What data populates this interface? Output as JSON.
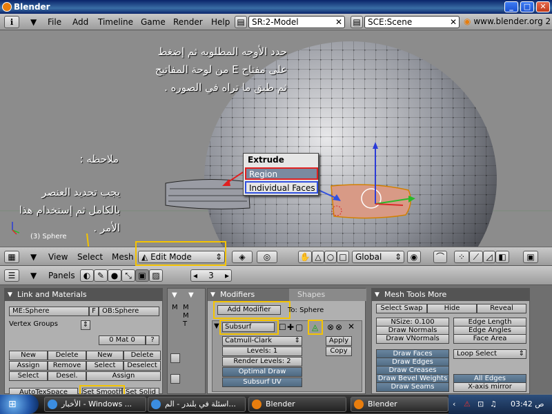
{
  "window": {
    "title": "Blender",
    "min": "_",
    "max": "□",
    "close": "✕"
  },
  "menubar": {
    "items": [
      "File",
      "Add",
      "Timeline",
      "Game",
      "Render",
      "Help"
    ],
    "screen": "SR:2-Model",
    "scene": "SCE:Scene",
    "url": "www.blender.org 2"
  },
  "viewport": {
    "instruction_lines": [
      "حدد الأوجه المطلوبه ثم إضغط",
      "على مفتاح E من لوحة المفاتيح",
      "ثم طبق ما تراه في الصوره ."
    ],
    "note_title": "ملاحظه :",
    "note_lines": [
      "يجب تحديد العنصر",
      "بالكامل ثم إستخدام هذا",
      "الأمر ."
    ],
    "object_label": "(3) Sphere",
    "extrude_menu": {
      "title": "Extrude",
      "options": [
        "Region",
        "Individual Faces"
      ]
    }
  },
  "header3d": {
    "view": "View",
    "select": "Select",
    "mesh": "Mesh",
    "mode": "Edit Mode",
    "orientation": "Global"
  },
  "buttons_header": {
    "panels": "Panels",
    "frame": "3"
  },
  "link_panel": {
    "title": "Link and Materials",
    "mesh_name": "ME:Sphere",
    "f_label": "F",
    "ob_name": "OB:Sphere",
    "vertex_groups": "Vertex Groups",
    "mat": "0 Mat 0",
    "help": "?",
    "buttons": [
      "New",
      "Delete",
      "Assign",
      "Remove",
      "Select",
      "Desel."
    ],
    "mat_buttons": [
      "New",
      "Delete",
      "Select",
      "Deselect",
      "Assign"
    ],
    "set_smooth": "Set Smooth",
    "set_solid": "Set Solid",
    "autotex": "AutoTexSpace"
  },
  "modifiers_panel": {
    "tab_modifiers": "Modifiers",
    "tab_shapes": "Shapes",
    "add_modifier": "Add Modifier",
    "to_label": "To: Sphere",
    "subsurf_name": "Subsurf",
    "type": "Catmull-Clark",
    "levels": "Levels: 1",
    "render_levels": "Render Levels: 2",
    "optimal_draw": "Optimal Draw",
    "subsurf_uv": "Subsurf UV",
    "apply": "Apply",
    "copy": "Copy",
    "col_labels": [
      "M",
      "M",
      "M",
      "T"
    ]
  },
  "mesh_tools_panel": {
    "title": "Mesh Tools More",
    "select_swap": "Select Swap",
    "hide": "Hide",
    "reveal": "Reveal",
    "nsize": "NSize: 0.100",
    "draw_normals": "Draw Normals",
    "draw_vnormals": "Draw VNormals",
    "edge_length": "Edge Length",
    "edge_angles": "Edge Angles",
    "face_area": "Face Area",
    "draw_faces": "Draw Faces",
    "draw_edges": "Draw Edges",
    "draw_creases": "Draw Creases",
    "draw_bevel": "Draw Bevel Weights",
    "draw_seams": "Draw Seams",
    "loop_select": "Loop Select",
    "all_edges": "All Edges",
    "xmirror": "X-axis mirror"
  },
  "taskbar": {
    "tasks": [
      "الأخبار - Windows ...",
      "اسئلة في بلندر - الم...",
      "Blender",
      "Blender"
    ],
    "time": "03:42 ص"
  }
}
